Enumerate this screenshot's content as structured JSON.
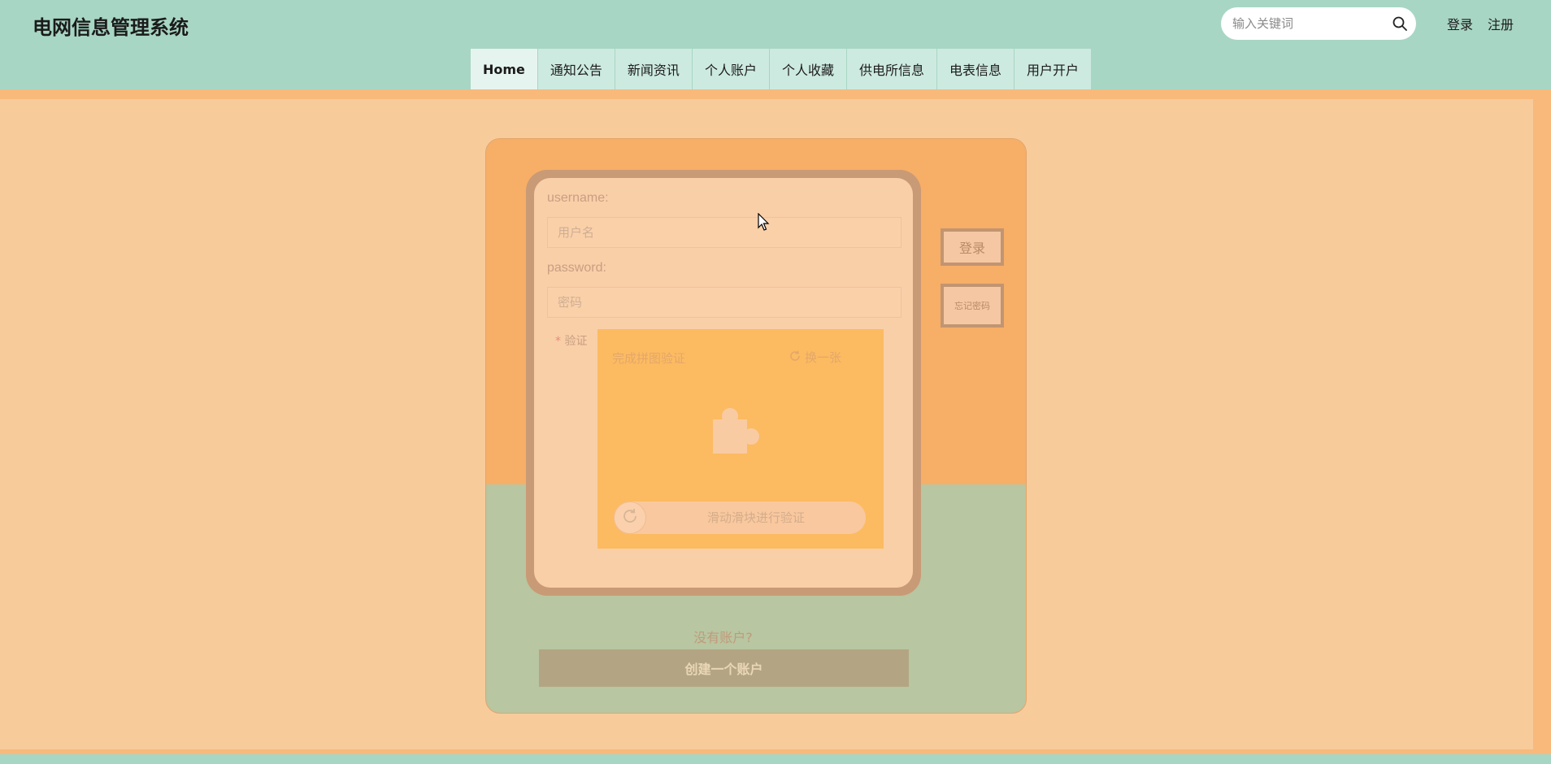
{
  "header": {
    "site_title": "电网信息管理系统",
    "search_placeholder": "输入关键词",
    "login_link": "登录",
    "register_link": "注册",
    "icons": {
      "search": "search-icon"
    }
  },
  "nav": {
    "items": [
      {
        "label": "Home",
        "active": true
      },
      {
        "label": "通知公告"
      },
      {
        "label": "新闻资讯"
      },
      {
        "label": "个人账户"
      },
      {
        "label": "个人收藏"
      },
      {
        "label": "供电所信息"
      },
      {
        "label": "电表信息"
      },
      {
        "label": "用户开户"
      }
    ]
  },
  "login_form": {
    "username_label": "username:",
    "username_placeholder": "用户名",
    "password_label": "password:",
    "password_placeholder": "密码",
    "verify_star": "*",
    "verify_label": "验证",
    "captcha": {
      "title": "完成拼图验证",
      "refresh_label": "换一张",
      "slider_text": "滑动滑块进行验证"
    },
    "login_button": "登录",
    "forgot_button": "忘记密码",
    "no_account_text": "没有账户?",
    "create_account_button": "创建一个账户"
  },
  "colors": {
    "header_bg": "#a8d6c4",
    "page_bg": "#f8cb9b",
    "card_top": "#f7ae67",
    "card_bottom": "#b8c6a1",
    "captcha_bg": "#fcbb61"
  }
}
